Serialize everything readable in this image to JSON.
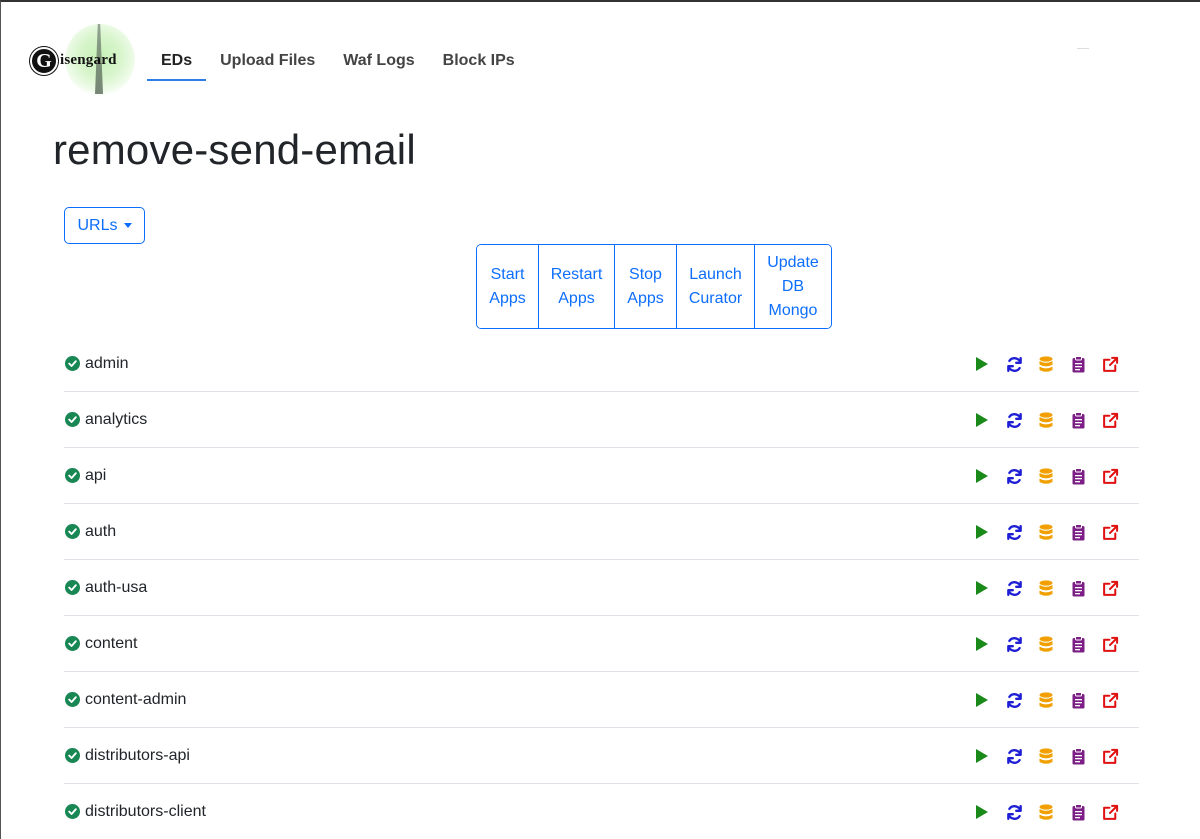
{
  "brand": {
    "logo_letter": "G",
    "logo_text": "isengard"
  },
  "nav": {
    "items": [
      {
        "label": "EDs",
        "active": true
      },
      {
        "label": "Upload Files",
        "active": false
      },
      {
        "label": "Waf Logs",
        "active": false
      },
      {
        "label": "Block IPs",
        "active": false
      }
    ]
  },
  "page": {
    "title": "remove-send-email"
  },
  "urls_dropdown": {
    "label": "URLs"
  },
  "actions_group": [
    {
      "label": "Start\nApps",
      "width": 62
    },
    {
      "label": "Restart\nApps",
      "width": 76
    },
    {
      "label": "Stop\nApps",
      "width": 62
    },
    {
      "label": "Launch\nCurator",
      "width": 78
    },
    {
      "label": "Update\nDB\nMongo",
      "width": 76
    }
  ],
  "services": [
    {
      "name": "admin",
      "status": "ok"
    },
    {
      "name": "analytics",
      "status": "ok"
    },
    {
      "name": "api",
      "status": "ok"
    },
    {
      "name": "auth",
      "status": "ok"
    },
    {
      "name": "auth-usa",
      "status": "ok"
    },
    {
      "name": "content",
      "status": "ok"
    },
    {
      "name": "content-admin",
      "status": "ok"
    },
    {
      "name": "distributors-api",
      "status": "ok"
    },
    {
      "name": "distributors-client",
      "status": "ok"
    }
  ],
  "row_actions": [
    {
      "icon": "play-icon",
      "color": "#1a8a1a"
    },
    {
      "icon": "refresh-icon",
      "color": "#1f1fd6"
    },
    {
      "icon": "database-icon",
      "color": "#f0a000"
    },
    {
      "icon": "clipboard-icon",
      "color": "#7b1f86"
    },
    {
      "icon": "external-link-icon",
      "color": "#e01010"
    }
  ],
  "colors": {
    "primary": "#0d6efd",
    "success": "#198754",
    "nav_active_underline": "#2b7de9"
  }
}
